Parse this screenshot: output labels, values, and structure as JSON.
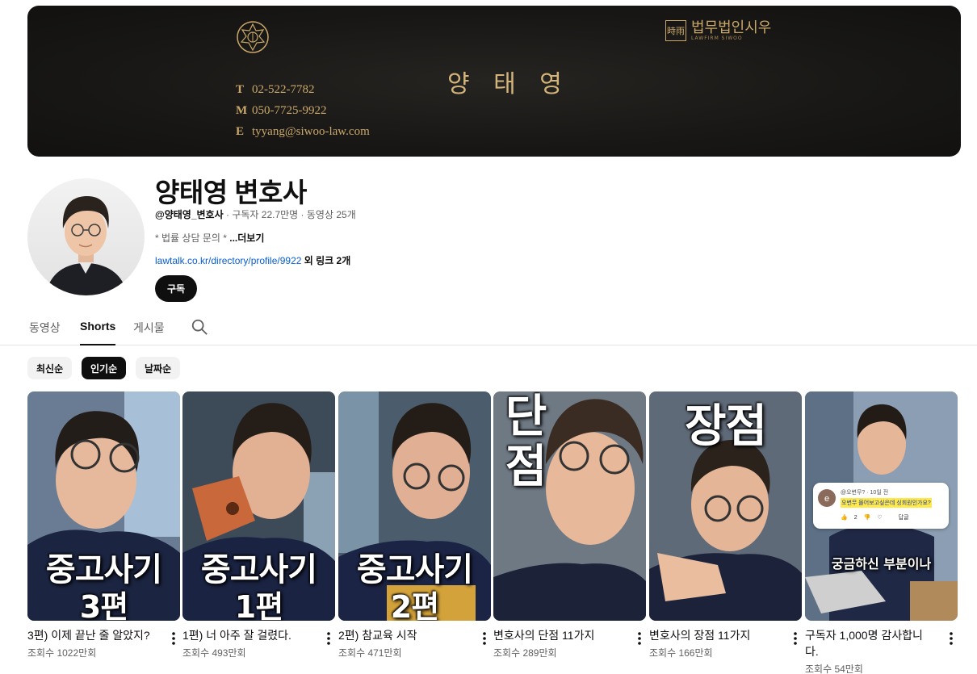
{
  "banner": {
    "brand_box": "時雨",
    "brand_name": "법무법인시우",
    "brand_sub": "LAWFIRM SIWOO",
    "name": "양 태 영",
    "contacts": [
      {
        "key": "T",
        "value": "02-522-7782"
      },
      {
        "key": "M",
        "value": "050-7725-9922"
      },
      {
        "key": "E",
        "value": "tyyang@siwoo-law.com"
      }
    ],
    "bg_color": "#181715",
    "gold_color": "#c9a86a"
  },
  "channel": {
    "title": "양태영 변호사",
    "handle": "@양태영_변호사",
    "subscribers": "구독자 22.7만명",
    "videos": "동영상 25개",
    "desc": "* 법률 상담 문의 *",
    "more": "...더보기",
    "link": "lawtalk.co.kr/directory/profile/9922",
    "link_extra": "외 링크 2개",
    "subscribe_label": "구독"
  },
  "tabs": {
    "videos": "동영상",
    "shorts": "Shorts",
    "posts": "게시물"
  },
  "chips": {
    "latest": "최신순",
    "popular": "인기순",
    "oldest": "날짜순"
  },
  "shorts": [
    {
      "title": "3편) 이제 끝난 줄 알았지?",
      "views": "조회수 1022만회",
      "overlay1": "중고사기",
      "overlay2": "3편"
    },
    {
      "title": "1편) 너 아주 잘 걸렸다.",
      "views": "조회수 493만회",
      "overlay1": "중고사기",
      "overlay2": "1편"
    },
    {
      "title": "2편) 참교육 시작",
      "views": "조회수 471만회",
      "overlay1": "중고사기",
      "overlay2": "2편"
    },
    {
      "title": "변호사의 단점 11가지",
      "views": "조회수 289만회",
      "overlay1": "단",
      "overlay2": "점"
    },
    {
      "title": "변호사의 장점 11가지",
      "views": "조회수 166만회",
      "overlay1": "장점",
      "overlay2": ""
    },
    {
      "title": "구독자 1,000명 감사합니다.",
      "views": "조회수 54만회",
      "overlay1": "궁금하신 부분이나",
      "overlay2": "",
      "comment": {
        "author": "@오변무? · 10일 전",
        "text": "오변무 몰어보고싶은데 싱회원인가요?",
        "likes": "2",
        "reply": "답글"
      }
    }
  ],
  "colors": {
    "accent": "#0f0f0f",
    "link": "#065fd4",
    "meta": "#606060"
  }
}
